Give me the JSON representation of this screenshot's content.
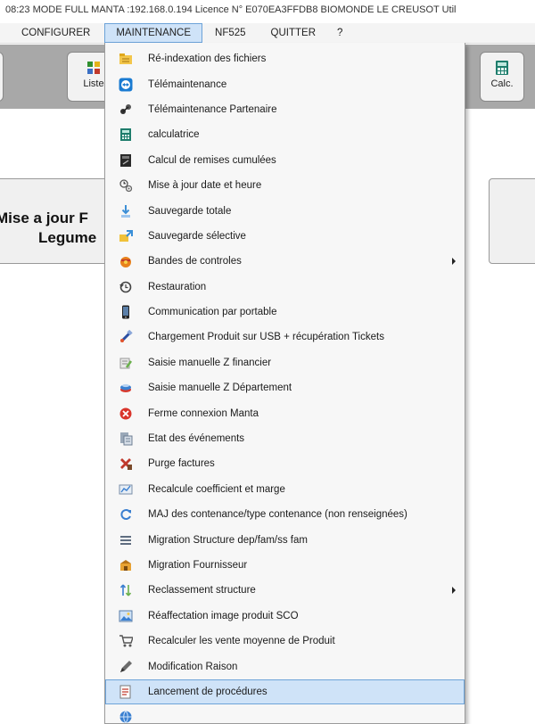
{
  "titlebar": {
    "text": "08:23 MODE FULL MANTA :192.168.0.194   Licence N° E070EA3FFDB8 BIOMONDE LE CREUSOT Util"
  },
  "menubar": {
    "items": [
      "CONFIGURER",
      "MAINTENANCE",
      "NF525",
      "QUITTER",
      "?"
    ],
    "active": "MAINTENANCE"
  },
  "toolbar": {
    "liste_label": "Liste",
    "calc_label": "Calc."
  },
  "content": {
    "big_button_line1": "Mise a jour F",
    "big_button_line2": "Legume"
  },
  "maintenance_menu": [
    {
      "label": "Ré-indexation des fichiers",
      "icon": "folder-index-icon"
    },
    {
      "label": "Télémaintenance",
      "icon": "teamviewer-icon"
    },
    {
      "label": "Télémaintenance Partenaire",
      "icon": "partner-remote-icon"
    },
    {
      "label": "calculatrice",
      "icon": "calculator-icon"
    },
    {
      "label": "Calcul de remises cumulées",
      "icon": "discount-calc-icon"
    },
    {
      "label": "Mise à jour date et heure",
      "icon": "clock-gears-icon"
    },
    {
      "label": "Sauvegarde totale",
      "icon": "backup-total-icon"
    },
    {
      "label": "Sauvegarde sélective",
      "icon": "backup-selective-icon"
    },
    {
      "label": "Bandes de controles",
      "icon": "control-tape-icon",
      "submenu": true
    },
    {
      "label": "Restauration",
      "icon": "restore-icon"
    },
    {
      "label": "Communication par portable",
      "icon": "mobile-phone-icon"
    },
    {
      "label": "Chargement Produit sur USB + récupération Tickets",
      "icon": "usb-icon"
    },
    {
      "label": "Saisie manuelle Z financier",
      "icon": "manual-z-finance-icon"
    },
    {
      "label": "Saisie manuelle Z Département",
      "icon": "manual-z-department-icon"
    },
    {
      "label": "Ferme connexion Manta",
      "icon": "close-connection-icon"
    },
    {
      "label": "Etat des événements",
      "icon": "events-icon"
    },
    {
      "label": "Purge factures",
      "icon": "purge-icon"
    },
    {
      "label": "Recalcule coefficient et marge",
      "icon": "recalc-margin-icon"
    },
    {
      "label": "MAJ des contenance/type contenance (non renseignées)",
      "icon": "refresh-icon"
    },
    {
      "label": "Migration Structure dep/fam/ss fam",
      "icon": "list-structure-icon"
    },
    {
      "label": "Migration Fournisseur",
      "icon": "supplier-icon"
    },
    {
      "label": "Reclassement structure",
      "icon": "reclass-icon",
      "submenu": true
    },
    {
      "label": "Réaffectation image produit SCO",
      "icon": "image-icon"
    },
    {
      "label": "Recalculer les vente moyenne de Produit",
      "icon": "cart-icon"
    },
    {
      "label": "Modification Raison",
      "icon": "edit-pen-icon"
    },
    {
      "label": "Lancement de procédures",
      "icon": "procedure-icon",
      "highlight": true
    },
    {
      "label": "",
      "icon": "globe-icon"
    }
  ]
}
